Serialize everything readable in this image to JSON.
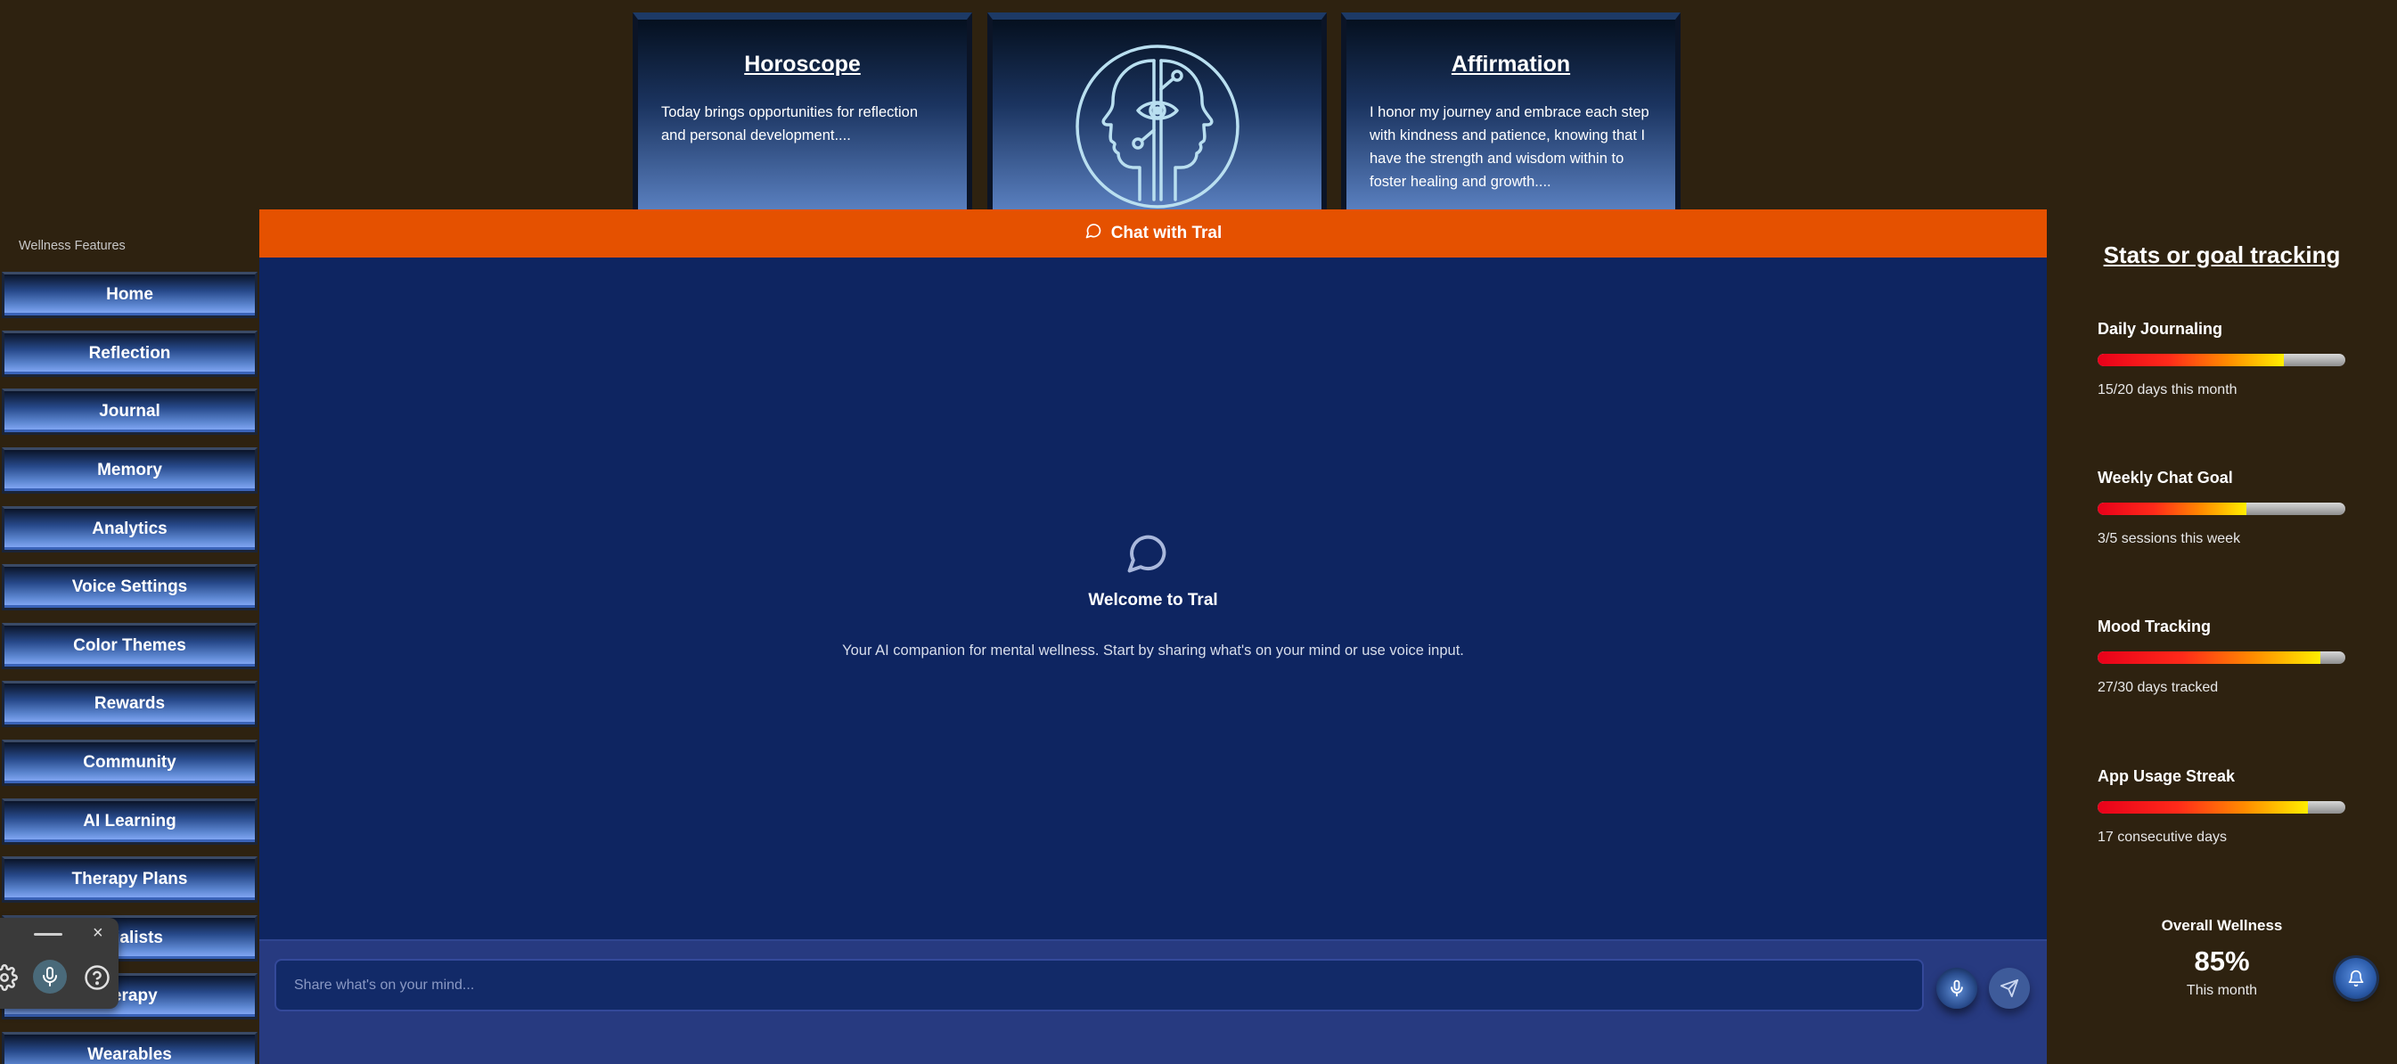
{
  "cards": {
    "horoscope": {
      "title": "Horoscope",
      "text": "Today brings opportunities for reflection and personal development...."
    },
    "affirmation": {
      "title": "Affirmation",
      "text": "I honor my journey and embrace each step with kindness and patience, knowing that I have the strength and wisdom within to foster healing and growth...."
    },
    "logo_icon": "dual-head-mind-eye-icon"
  },
  "sidebar": {
    "heading": "Wellness Features",
    "items": [
      {
        "label": "Home"
      },
      {
        "label": "Reflection"
      },
      {
        "label": "Journal"
      },
      {
        "label": "Memory"
      },
      {
        "label": "Analytics"
      },
      {
        "label": "Voice Settings"
      },
      {
        "label": "Color Themes"
      },
      {
        "label": "Rewards"
      },
      {
        "label": "Community"
      },
      {
        "label": "AI Learning"
      },
      {
        "label": "Therapy Plans"
      },
      {
        "label": "ecialists"
      },
      {
        "label": "herapy"
      },
      {
        "label": "Wearables"
      }
    ]
  },
  "mini_toolbar": {
    "close_glyph": "×",
    "icons": [
      "drag-handle",
      "gear-icon",
      "microphone-icon",
      "help-icon"
    ]
  },
  "chat": {
    "header_label": "Chat with Tral",
    "welcome_title": "Welcome to Tral",
    "welcome_subtitle": "Your AI companion for mental wellness. Start by sharing what's on your mind or use voice input.",
    "input_placeholder": "Share what's on your mind..."
  },
  "stats": {
    "title": "Stats or goal tracking",
    "items": [
      {
        "label": "Daily Journaling",
        "detail": "15/20 days this month",
        "progress": 0.75
      },
      {
        "label": "Weekly Chat Goal",
        "detail": "3/5 sessions this week",
        "progress": 0.6
      },
      {
        "label": "Mood Tracking",
        "detail": "27/30 days tracked",
        "progress": 0.9
      },
      {
        "label": "App Usage Streak",
        "detail": "17 consecutive days",
        "progress": 0.85
      }
    ],
    "overall": {
      "label": "Overall Wellness",
      "value": "85%",
      "period": "This month"
    }
  },
  "colors": {
    "page_background": "#2e2210",
    "chat_header": "#e55100",
    "chat_background": "#0e2561",
    "input_bar": "#273a80"
  }
}
